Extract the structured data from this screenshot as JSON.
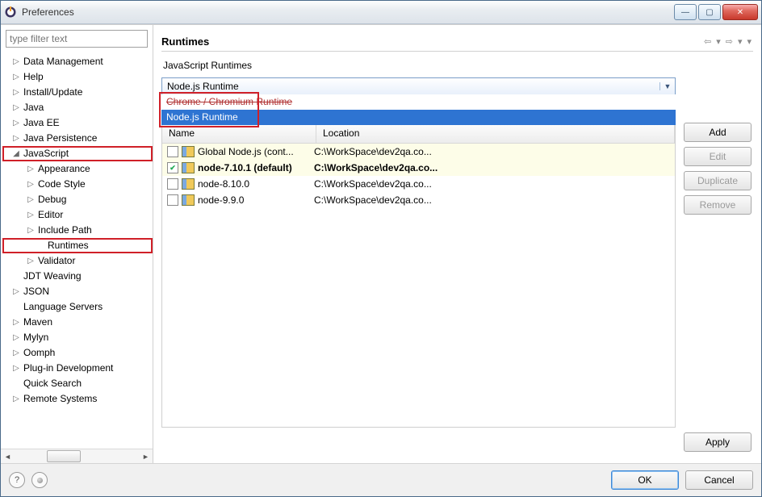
{
  "window": {
    "title": "Preferences"
  },
  "filter": {
    "placeholder": "type filter text"
  },
  "tree": {
    "data_mgmt": "Data Management",
    "help": "Help",
    "install": "Install/Update",
    "java": "Java",
    "javaee": "Java EE",
    "javapers": "Java Persistence",
    "javascript": "JavaScript",
    "appearance": "Appearance",
    "codestyle": "Code Style",
    "debug": "Debug",
    "editor": "Editor",
    "includepath": "Include Path",
    "runtimes": "Runtimes",
    "validator": "Validator",
    "jdtweaving": "JDT Weaving",
    "json": "JSON",
    "langservers": "Language Servers",
    "maven": "Maven",
    "mylyn": "Mylyn",
    "oomph": "Oomph",
    "plugindev": "Plug-in Development",
    "quicksearch": "Quick Search",
    "remotesys": "Remote Systems"
  },
  "page": {
    "title": "Runtimes",
    "subtitle": "JavaScript Runtimes",
    "dropdown": {
      "selected": "Node.js Runtime",
      "options": {
        "chrome": "Chrome / Chromium Runtime",
        "node": "Node.js Runtime"
      }
    },
    "table": {
      "col_name": "Name",
      "col_location": "Location",
      "rows": [
        {
          "checked": false,
          "name": "Global Node.js (cont...",
          "location": "C:\\WorkSpace\\dev2qa.co...",
          "bold": false,
          "hl": true
        },
        {
          "checked": true,
          "name": "node-7.10.1 (default)",
          "location": "C:\\WorkSpace\\dev2qa.co...",
          "bold": true,
          "hl": true
        },
        {
          "checked": false,
          "name": "node-8.10.0",
          "location": "C:\\WorkSpace\\dev2qa.co...",
          "bold": false,
          "hl": false
        },
        {
          "checked": false,
          "name": "node-9.9.0",
          "location": "C:\\WorkSpace\\dev2qa.co...",
          "bold": false,
          "hl": false
        }
      ]
    },
    "buttons": {
      "add": "Add",
      "edit": "Edit",
      "duplicate": "Duplicate",
      "remove": "Remove",
      "apply": "Apply",
      "ok": "OK",
      "cancel": "Cancel"
    }
  }
}
